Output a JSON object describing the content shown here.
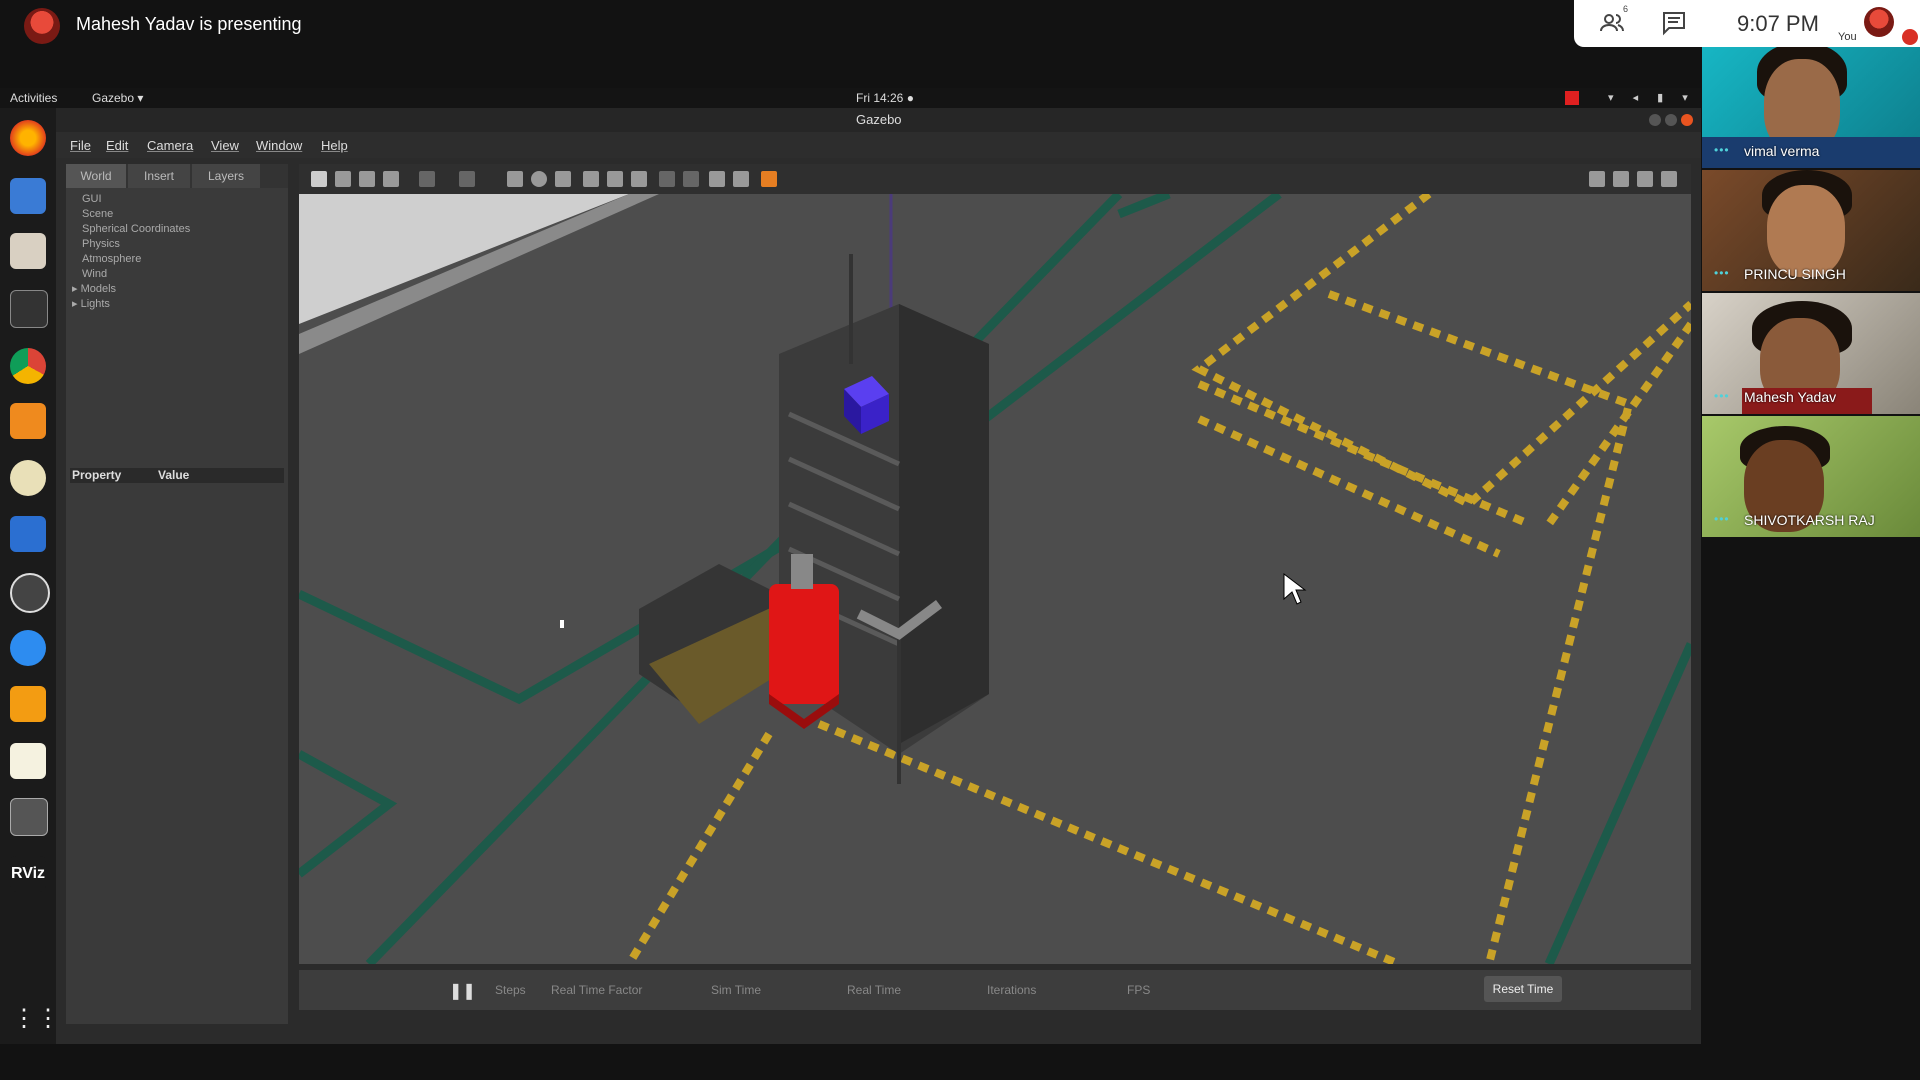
{
  "meet": {
    "presenting_text": "Mahesh Yadav is presenting",
    "people_count": "6",
    "time": "9:07 PM",
    "you_label": "You",
    "participants": [
      {
        "name": "vimal verma"
      },
      {
        "name": "PRINCU SINGH"
      },
      {
        "name": "Mahesh Yadav"
      },
      {
        "name": "SHIVOTKARSH RAJ"
      }
    ]
  },
  "desktop": {
    "activities": "Activities",
    "app_menu": "Gazebo ▾",
    "clock": "Fri 14:26 ●"
  },
  "gazebo": {
    "title": "Gazebo",
    "menus": [
      "File",
      "Edit",
      "Camera",
      "View",
      "Window",
      "Help"
    ],
    "tabs": [
      "World",
      "Insert",
      "Layers"
    ],
    "world_tree": [
      "GUI",
      "Scene",
      "Spherical Coordinates",
      "Physics",
      "Atmosphere",
      "Wind",
      "Models",
      "Lights"
    ],
    "property_header": {
      "property": "Property",
      "value": "Value"
    },
    "timebar": {
      "steps": "Steps",
      "rtf_label": "Real Time Factor",
      "sim_time_label": "Sim Time",
      "real_time_label": "Real Time",
      "iterations_label": "Iterations",
      "fps_label": "FPS",
      "reset": "Reset Time"
    }
  },
  "colors": {
    "meet_bg": "#121212",
    "floor": "#4d4d4d",
    "lane_green": "#1d5a4a",
    "hazard_yellow": "#c9a227",
    "red_model": "#e01616",
    "blue_box": "#3a22c8"
  }
}
